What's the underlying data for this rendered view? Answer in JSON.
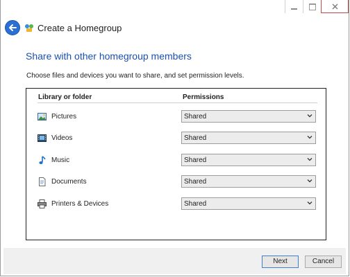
{
  "window": {
    "title": "Create a Homegroup",
    "caption_icons": [
      "minimize-icon",
      "maximize-icon",
      "close-icon"
    ]
  },
  "heading": "Share with other homegroup members",
  "intro": "Choose files and devices you want to share, and set permission levels.",
  "table": {
    "col_library": "Library or folder",
    "col_permissions": "Permissions",
    "rows": [
      {
        "label": "Pictures",
        "icon": "pictures-icon",
        "value": "Shared"
      },
      {
        "label": "Videos",
        "icon": "videos-icon",
        "value": "Shared"
      },
      {
        "label": "Music",
        "icon": "music-icon",
        "value": "Shared"
      },
      {
        "label": "Documents",
        "icon": "documents-icon",
        "value": "Shared"
      },
      {
        "label": "Printers & Devices",
        "icon": "printer-icon",
        "value": "Shared"
      }
    ]
  },
  "buttons": {
    "next": "Next",
    "cancel": "Cancel"
  },
  "colors": {
    "accent": "#2a6fd3",
    "heading": "#1c4fb0",
    "close_border": "#c44a4a"
  }
}
